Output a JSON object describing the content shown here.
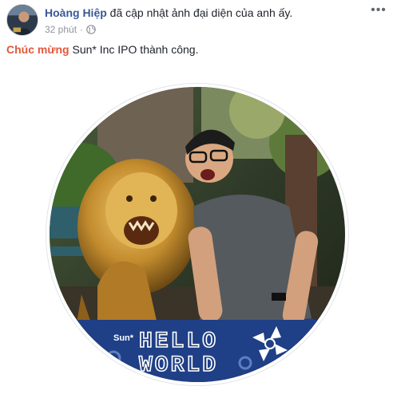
{
  "post": {
    "author": "Hoàng Hiệp",
    "action": "đã cập nhật ảnh đại diện của anh ấy.",
    "time": "32 phút",
    "separator": "·",
    "privacy_icon": "globe-icon",
    "menu_icon": "more-options-icon",
    "text_highlight": "Chúc mừng",
    "text_rest": " Sun* Inc IPO thành công."
  },
  "frame": {
    "brand": "Sun*",
    "line1": "HELLO",
    "line2": "WORLD"
  },
  "colors": {
    "author": "#385898",
    "highlight": "#e2573b",
    "banner": "#1f3f86",
    "meta": "#90949c"
  }
}
